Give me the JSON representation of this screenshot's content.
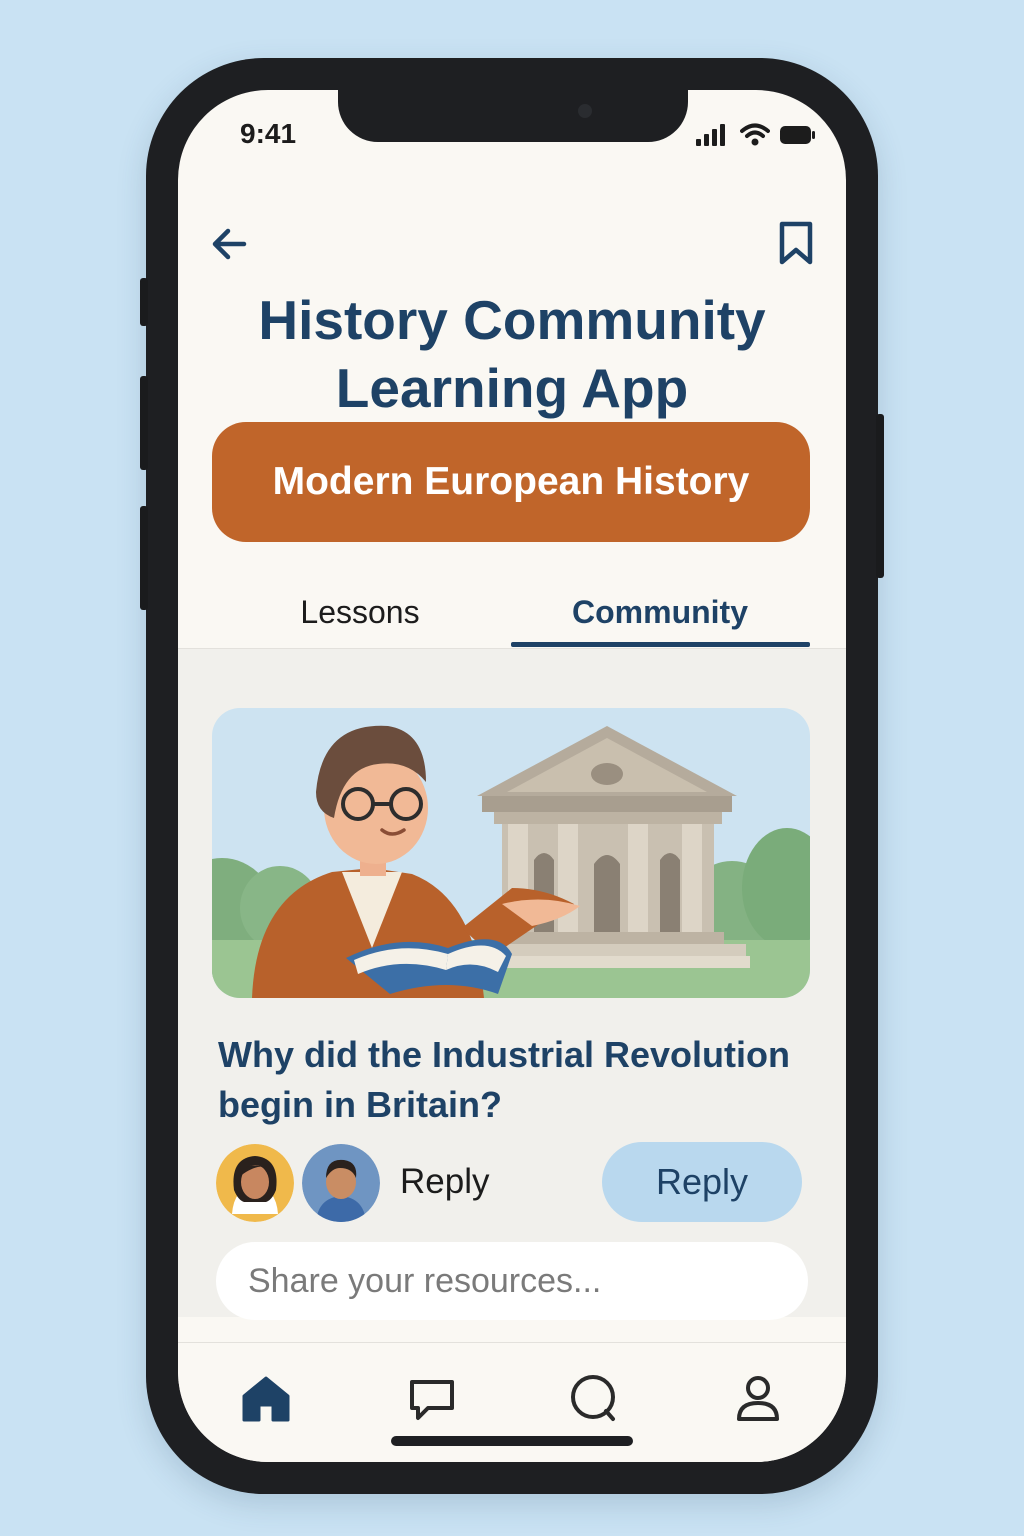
{
  "status_bar": {
    "time": "9:41"
  },
  "header": {
    "back_icon": "arrow-left-icon",
    "bookmark_icon": "bookmark-icon",
    "title_line1": "History Community",
    "title_line2": "Learning App"
  },
  "course": {
    "label": "Modern European History"
  },
  "tabs": [
    {
      "label": "Lessons",
      "active": false
    },
    {
      "label": "Community",
      "active": true
    }
  ],
  "post": {
    "question_line1": "Why did the Industrial Revolution",
    "question_line2": "begin in Britain?",
    "reply_text": "Reply",
    "reply_button": "Reply"
  },
  "composer": {
    "placeholder": "Share your resources..."
  },
  "bottom_nav": [
    {
      "icon": "home-icon",
      "active": true
    },
    {
      "icon": "chat-bubble-icon",
      "active": false
    },
    {
      "icon": "search-icon",
      "active": false
    },
    {
      "icon": "profile-icon",
      "active": false
    }
  ],
  "colors": {
    "accent": "#c0652a",
    "primary": "#1e4266",
    "reply_bg": "#b9d8ee",
    "background": "#c9e2f3"
  }
}
